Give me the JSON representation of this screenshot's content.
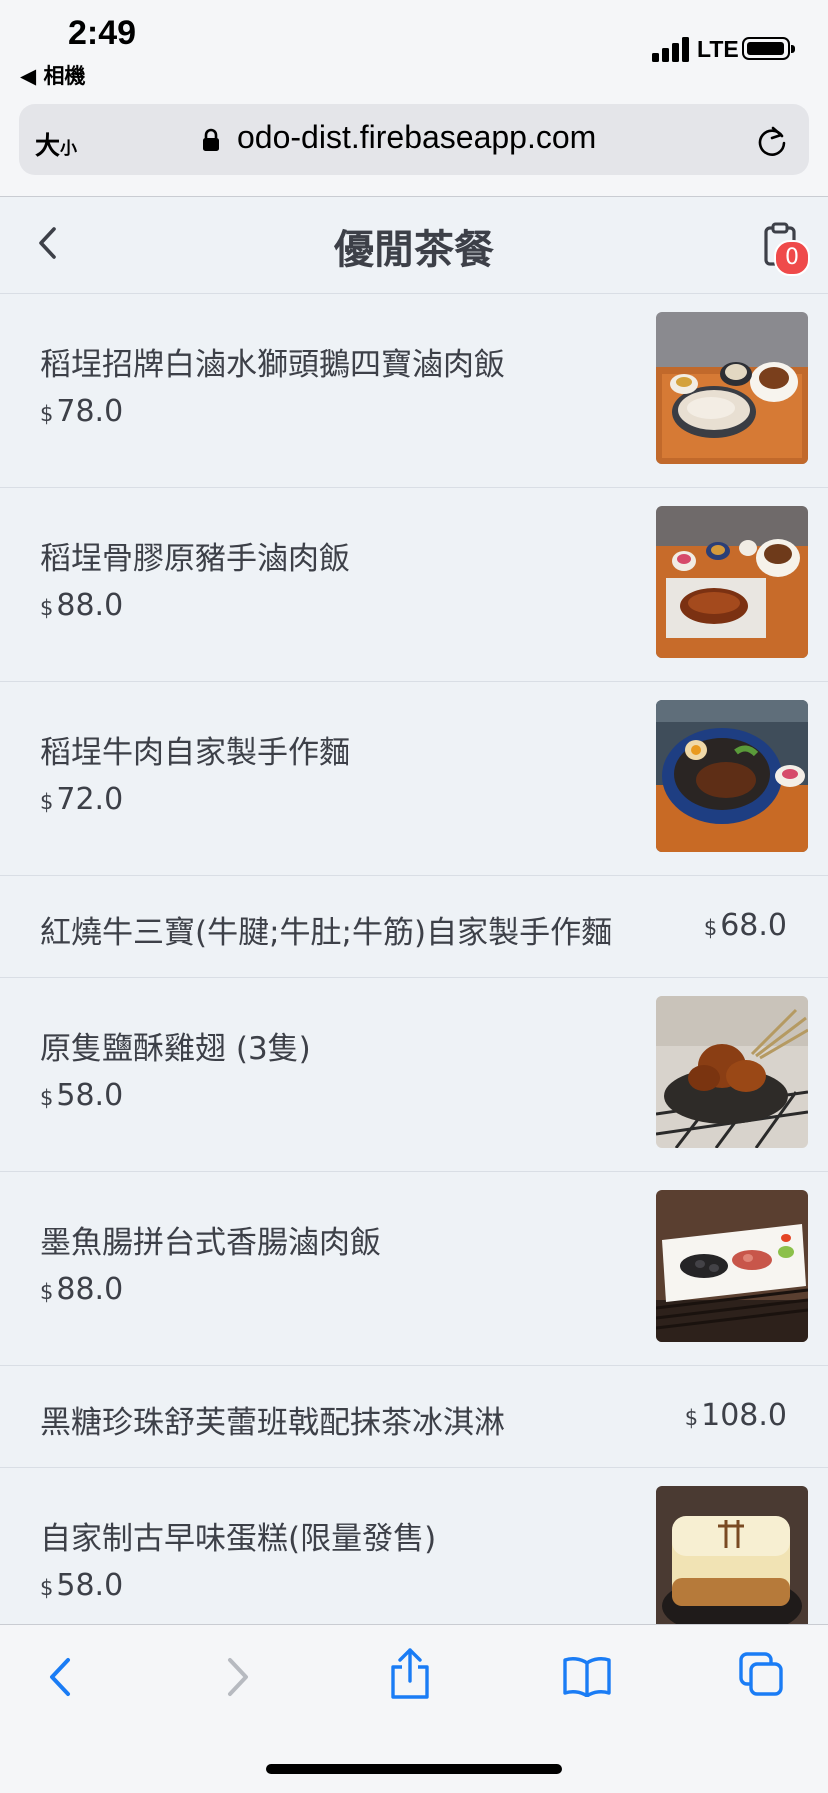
{
  "status": {
    "time": "2:49",
    "back_app": "◀ 相機",
    "network": "LTE",
    "signal_icon": "cellular-signal-icon",
    "battery_icon": "battery-icon"
  },
  "browser": {
    "text_size_label": "大",
    "text_size_small": "小",
    "url": "odo-dist.firebaseapp.com",
    "lock_icon": "lock-icon",
    "reload_icon": "reload-icon"
  },
  "header": {
    "title": "優閒茶餐",
    "cart_count": "0",
    "back_icon": "chevron-left-icon",
    "cart_icon": "clipboard-icon"
  },
  "currency": "$",
  "menu_items": [
    {
      "name": "稻埕招牌白滷水獅頭鵝四寶滷肉飯",
      "price": "78.0",
      "has_image": true
    },
    {
      "name": "稻埕骨膠原豬手滷肉飯",
      "price": "88.0",
      "has_image": true
    },
    {
      "name": "稻埕牛肉自家製手作麵",
      "price": "72.0",
      "has_image": true
    },
    {
      "name": "紅燒牛三寶(牛腱;牛肚;牛筋)自家製手作麵",
      "price": "68.0",
      "has_image": false
    },
    {
      "name": "原隻鹽酥雞翅 (3隻)",
      "price": "58.0",
      "has_image": true
    },
    {
      "name": "墨魚腸拼台式香腸滷肉飯",
      "price": "88.0",
      "has_image": true
    },
    {
      "name": "黑糖珍珠舒芙蕾班戟配抹茶冰淇淋",
      "price": "108.0",
      "has_image": false
    },
    {
      "name": "自家制古早味蛋糕(限量發售)",
      "price": "58.0",
      "has_image": true
    }
  ],
  "toolbar": {
    "icons": [
      "back-arrow-icon",
      "forward-arrow-icon",
      "share-icon",
      "bookmarks-icon",
      "tabs-icon"
    ]
  },
  "colors": {
    "accent": "#1a7cf5",
    "badge": "#ef4a4a",
    "background": "#eef2f6"
  }
}
